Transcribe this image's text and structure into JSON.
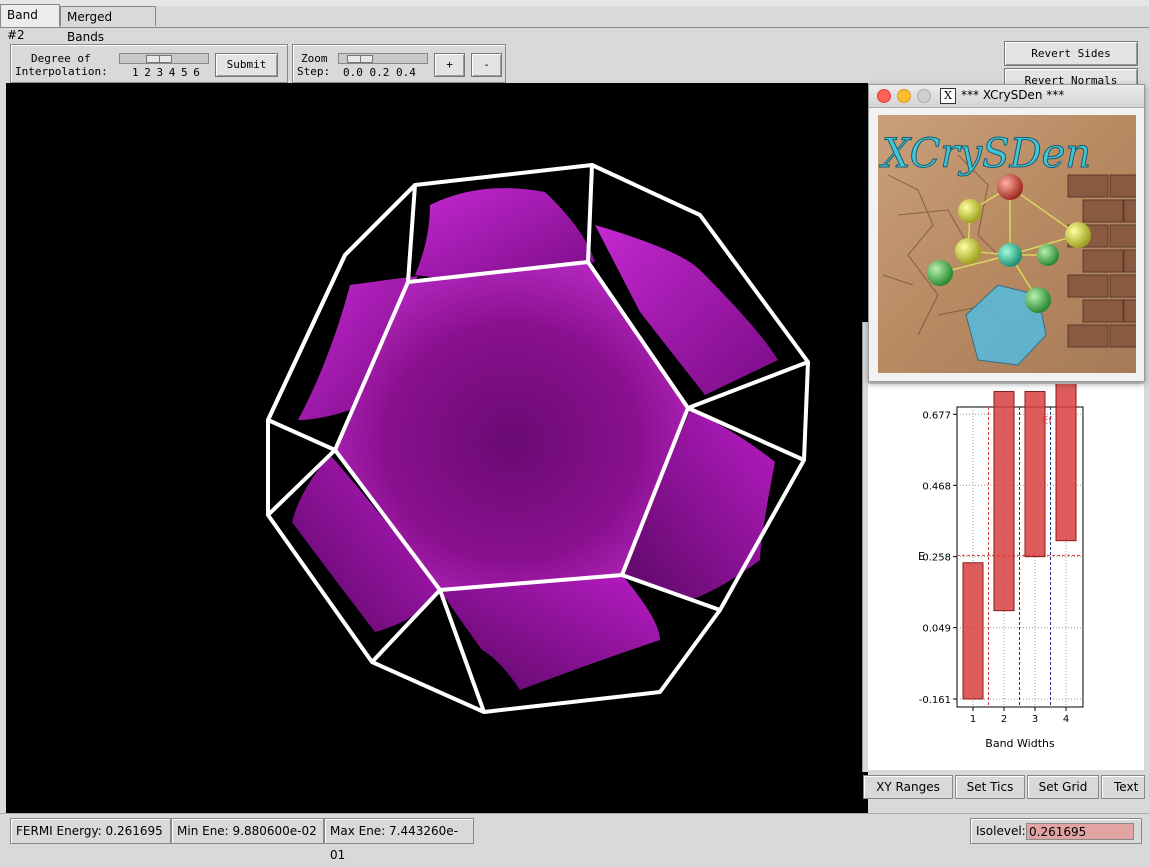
{
  "tabs": {
    "band": "Band #2",
    "merged": "Merged Bands"
  },
  "interp": {
    "label1": "Degree of",
    "label2": "Interpolation:",
    "ticks": "1 2 3 4 5 6",
    "submit": "Submit",
    "value": 3
  },
  "zoom": {
    "label1": "Zoom",
    "label2": "Step:",
    "ticks": "0.0 0.2 0.4",
    "plus": "+",
    "minus": "-"
  },
  "right_buttons": {
    "revert_sides": "Revert Sides",
    "revert_normals": "Revert Normals"
  },
  "logo_window": {
    "title": "*** XCrySDen ***",
    "logo_text": "XCrySDen",
    "x_icon": "X"
  },
  "chart_data": {
    "type": "bar",
    "xlabel": "Band Widths",
    "ylabel": "E",
    "categories": [
      "1",
      "2",
      "3",
      "4"
    ],
    "yticks": [
      "0.677",
      "0.468",
      "0.258",
      "0.049",
      "-0.161"
    ],
    "ytick_values": [
      0.677,
      0.468,
      0.258,
      0.049,
      -0.161
    ],
    "ylim": [
      -0.161,
      0.722
    ],
    "fermi_label": "Ef",
    "fermi_energy": 0.261695,
    "bands": [
      {
        "band": 1,
        "min": -0.161,
        "max": 0.24
      },
      {
        "band": 2,
        "min": 0.099,
        "max": 0.744
      },
      {
        "band": 3,
        "min": 0.258,
        "max": 0.744
      },
      {
        "band": 4,
        "min": 0.305,
        "max": 0.79
      }
    ],
    "grid": true
  },
  "plot_buttons": {
    "xy_ranges": "XY Ranges",
    "set_tics": "Set Tics",
    "set_grid": "Set Grid",
    "text": "Text"
  },
  "status": {
    "fermi": "FERMI Energy: 0.261695",
    "min_ene": "Min Ene: 9.880600e-02",
    "max_ene": "Max Ene: 7.443260e-01",
    "isolevel_label": "Isolevel:",
    "isolevel_value": "0.261695"
  },
  "colors": {
    "surface": "#a010b0",
    "wireframe": "#ffffff",
    "bars": "#d94040",
    "isolevel_bg": "#e2a3a3"
  }
}
